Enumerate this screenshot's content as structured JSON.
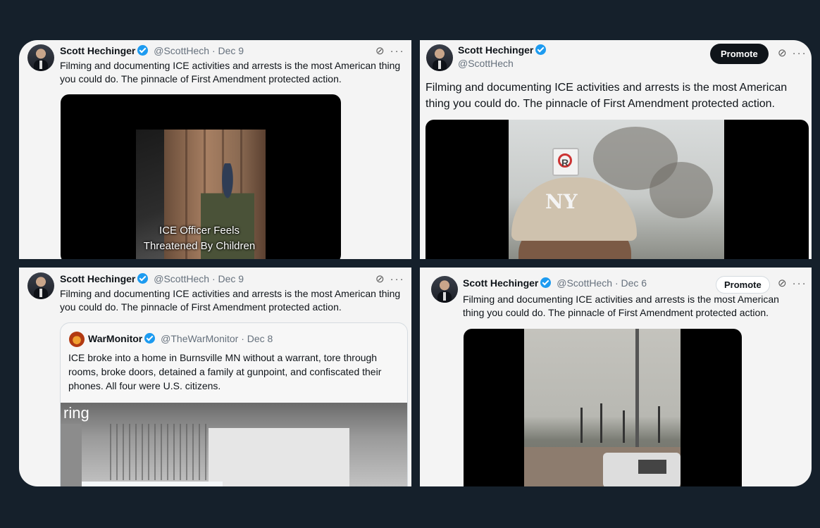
{
  "panels": [
    {
      "author": {
        "name": "Scott Hechinger",
        "handle": "@ScottHech",
        "date": "· Dec 9"
      },
      "text": "Filming and documenting ICE activities and arrests is the most American thing you could do. The pinnacle of First Amendment protected action.",
      "media_caption": "ICE Officer Feels Threatened By Children"
    },
    {
      "author": {
        "name": "Scott Hechinger",
        "handle": "@ScottHech"
      },
      "promote_label": "Promote",
      "text": "Filming and documenting ICE activities and arrests is the most American thing you could do. The pinnacle of First Amendment protected action."
    },
    {
      "author": {
        "name": "Scott Hechinger",
        "handle": "@ScottHech",
        "date": "· Dec 9"
      },
      "text": "Filming and documenting ICE activities and arrests is the most American thing you could do. The pinnacle of First Amendment protected action.",
      "quoted": {
        "author": {
          "name": "WarMonitor",
          "handle": "@TheWarMonitor",
          "date": "· Dec 8"
        },
        "text": "ICE broke into a home in Burnsville MN without a warrant, tore through rooms, broke doors, detained a family at gunpoint, and confiscated their phones. All four were U.S. citizens.",
        "media_logo": "ring"
      }
    },
    {
      "author": {
        "name": "Scott Hechinger",
        "handle": "@ScottHech",
        "date": "· Dec 6"
      },
      "promote_label": "Promote",
      "text": "Filming and documenting ICE activities and arrests is the most American thing you could do. The pinnacle of First Amendment protected action."
    }
  ],
  "icons": {
    "grok": "grok-icon",
    "more": "more-icon",
    "verified": "verified-badge-icon"
  },
  "colors": {
    "background": "#15202b",
    "verified": "#1d9bf0",
    "promote_dark": "#0f1419"
  }
}
